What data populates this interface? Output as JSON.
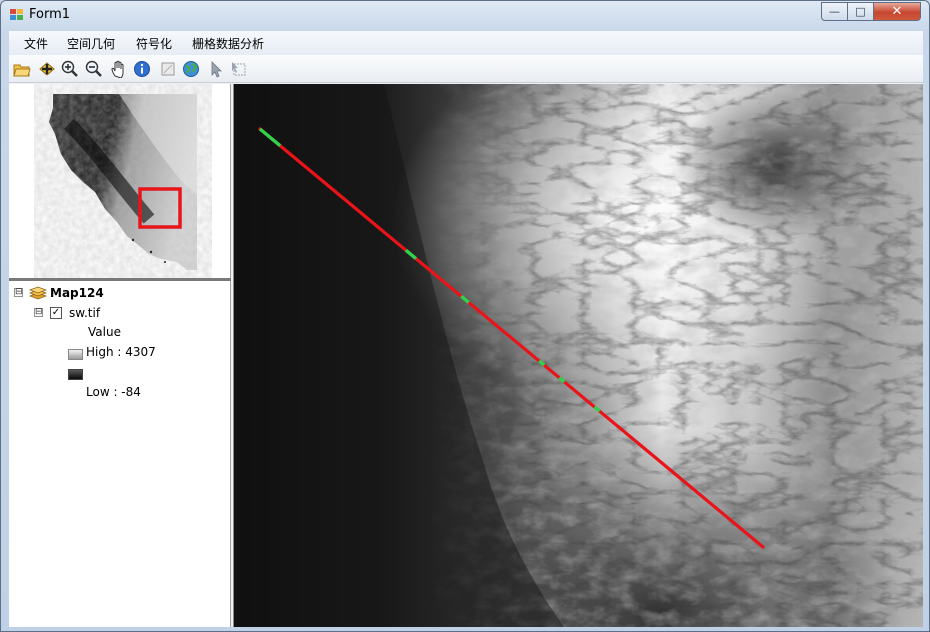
{
  "window": {
    "title": "Form1"
  },
  "title_buttons": {
    "minimize": "—",
    "maximize": "□",
    "close": "✕"
  },
  "menu": [
    "文件",
    "空间几何",
    "符号化",
    "栅格数据分析"
  ],
  "toolbar": [
    "open-icon",
    "add-data-icon",
    "zoom-in-icon",
    "zoom-out-icon",
    "pan-icon",
    "identify-icon",
    "full-extent-icon",
    "globe-icon",
    "select-arrow-icon",
    "clear-selection-icon"
  ],
  "toc": {
    "map_name": "Map124",
    "layer_name": "sw.tif",
    "layer_checked": true,
    "legend_field": "Value",
    "legend_high": "High : 4307",
    "legend_low": "Low : -84",
    "expander_map": "⊟",
    "expander_layer": "⊟",
    "check_mark": "✓"
  },
  "colors": {
    "profile_line": "#e8141a",
    "profile_highlight": "#2fd24a",
    "extent_box": "#e8141a"
  }
}
